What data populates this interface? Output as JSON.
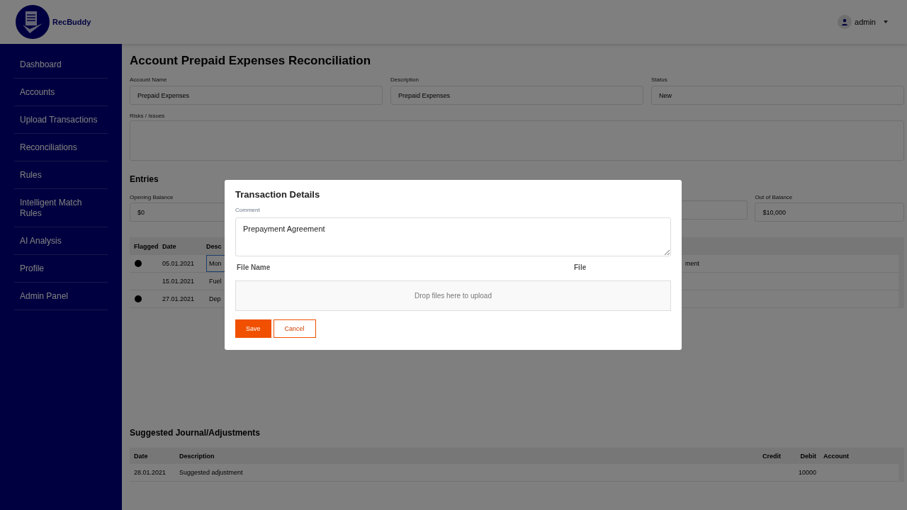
{
  "app": {
    "brand": "RecBuddy",
    "user": "admin"
  },
  "sidebar": {
    "items": [
      {
        "label": "Dashboard"
      },
      {
        "label": "Accounts"
      },
      {
        "label": "Upload Transactions"
      },
      {
        "label": "Reconciliations"
      },
      {
        "label": "Rules"
      },
      {
        "label": "Intelligent Match Rules"
      },
      {
        "label": "AI Analysis"
      },
      {
        "label": "Profile"
      },
      {
        "label": "Admin Panel"
      }
    ]
  },
  "page": {
    "title": "Account Prepaid Expenses Reconciliation",
    "fields": [
      {
        "label": "Account Name",
        "value": "Prepaid Expenses"
      },
      {
        "label": "Description",
        "value": "Prepaid Expenses"
      },
      {
        "label": "Status",
        "value": "New"
      }
    ],
    "risks": {
      "label": "Risks / Issues"
    }
  },
  "entries": {
    "title": "Entries",
    "balances": [
      {
        "label": "Opening Balance",
        "value": "$0"
      },
      {
        "label": "Out of Balance",
        "value": "$10,000"
      }
    ],
    "columns": [
      "Flagged",
      "Date",
      "Desc"
    ],
    "rows": [
      {
        "flagged": true,
        "date": "05.01.2021",
        "description": "Mon",
        "column_4": "ment",
        "focused": true
      },
      {
        "flagged": false,
        "date": "15.01.2021",
        "description": "Fuel",
        "focused": false
      },
      {
        "flagged": true,
        "date": "27.01.2021",
        "description": "Dep",
        "focused": false
      }
    ]
  },
  "journal": {
    "title": "Suggested Journal/Adjustments",
    "columns": [
      "Date",
      "Description",
      "Credit",
      "Debit",
      "Account"
    ],
    "rows": [
      {
        "date": "28.01.2021",
        "description": "Suggested adjustment",
        "debit": "10000"
      }
    ]
  },
  "dialog": {
    "title": "Transaction Details",
    "comment_label": "Comment",
    "comment": "Prepayment Agreement",
    "columns": [
      "File Name",
      "File"
    ],
    "dropzone": "Drop files here to upload",
    "buttons": [
      {
        "label": "Save",
        "kind": "primary"
      },
      {
        "label": "Cancel",
        "kind": "secondary"
      }
    ]
  }
}
